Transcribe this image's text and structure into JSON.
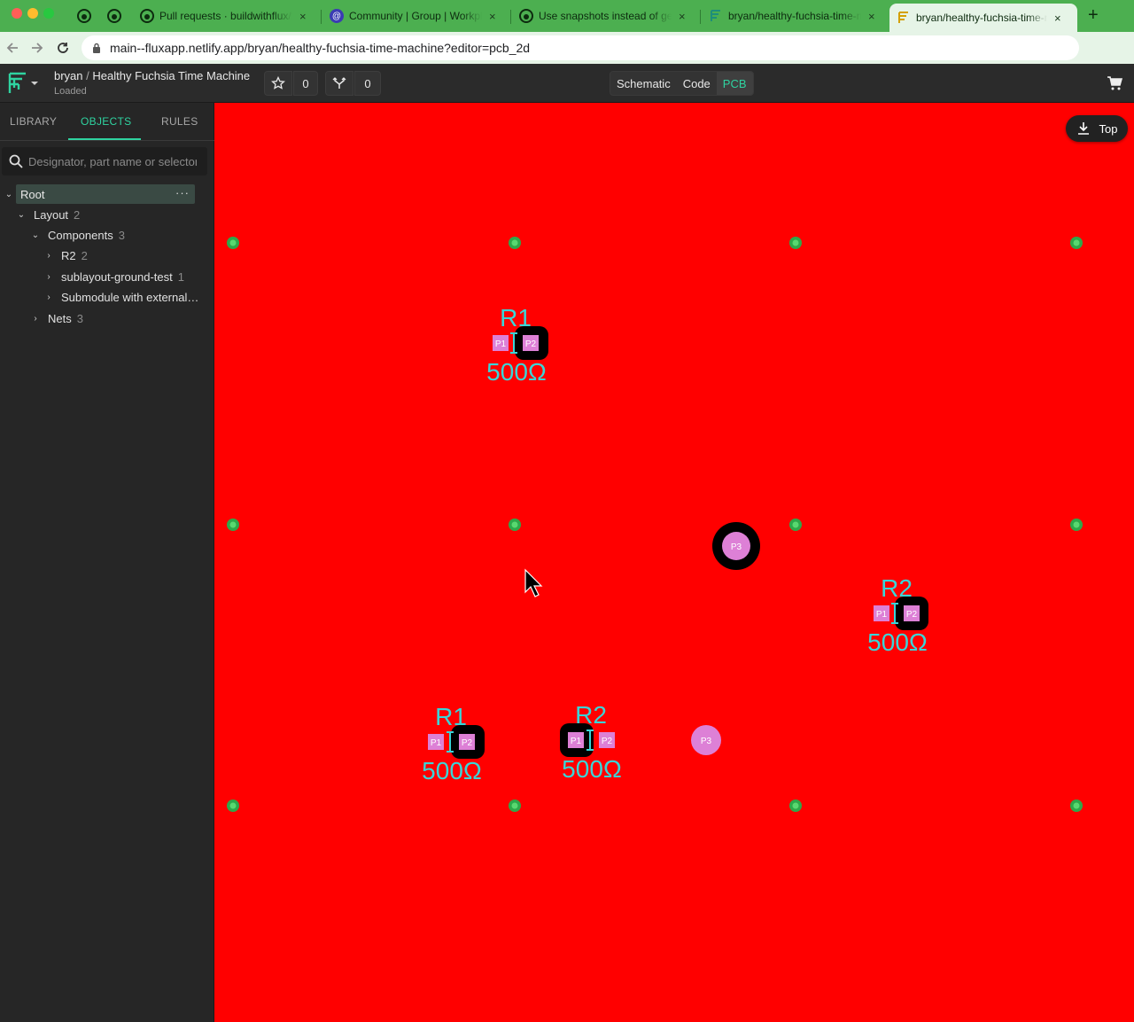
{
  "browser": {
    "tabs": [
      {
        "title": "Pull requests · buildwithflux/flux"
      },
      {
        "title": "Community | Group | Workplace"
      },
      {
        "title": "Use snapshots instead of getS"
      },
      {
        "title": "bryan/healthy-fuchsia-time-machine"
      },
      {
        "title": "bryan/healthy-fuchsia-time-machine"
      }
    ],
    "new_tab": "+",
    "close": "×",
    "url": "main--fluxapp.netlify.app/bryan/healthy-fuchsia-time-machine?editor=pcb_2d"
  },
  "header": {
    "owner": "bryan",
    "separator": "/",
    "project": "Healthy Fuchsia Time Machine",
    "status": "Loaded",
    "star_count": "0",
    "fork_count": "0",
    "modes": [
      "Schematic",
      "Code",
      "PCB"
    ],
    "active_mode": "PCB"
  },
  "sidebar": {
    "tabs": [
      "LIBRARY",
      "OBJECTS",
      "RULES"
    ],
    "search_placeholder": "Designator, part name or selector",
    "tree": {
      "root": "Root",
      "root_more": "···",
      "layout": {
        "label": "Layout",
        "count": "2"
      },
      "components": {
        "label": "Components",
        "count": "3"
      },
      "items": [
        {
          "label": "R2",
          "count": "2"
        },
        {
          "label": "sublayout-ground-test",
          "count": "1"
        },
        {
          "label": "Submodule with external…",
          "count": ""
        }
      ],
      "nets": {
        "label": "Nets",
        "count": "3"
      }
    }
  },
  "canvas": {
    "view_button": "Top",
    "background": "#ff0000",
    "label_color": "#39d5d8",
    "pad_color": "#dd80d6",
    "components": [
      {
        "designator": "R1",
        "value": "500Ω",
        "pads": [
          "P1",
          "P2"
        ]
      },
      {
        "designator": "R2",
        "value": "500Ω",
        "pads": [
          "P1",
          "P2"
        ]
      },
      {
        "designator": "R1",
        "value": "500Ω",
        "pads": [
          "P1",
          "P2"
        ]
      },
      {
        "designator": "R2",
        "value": "500Ω",
        "pads": [
          "P1",
          "P2"
        ]
      }
    ],
    "round_pads": [
      {
        "label": "P3"
      },
      {
        "label": "P3"
      }
    ]
  }
}
